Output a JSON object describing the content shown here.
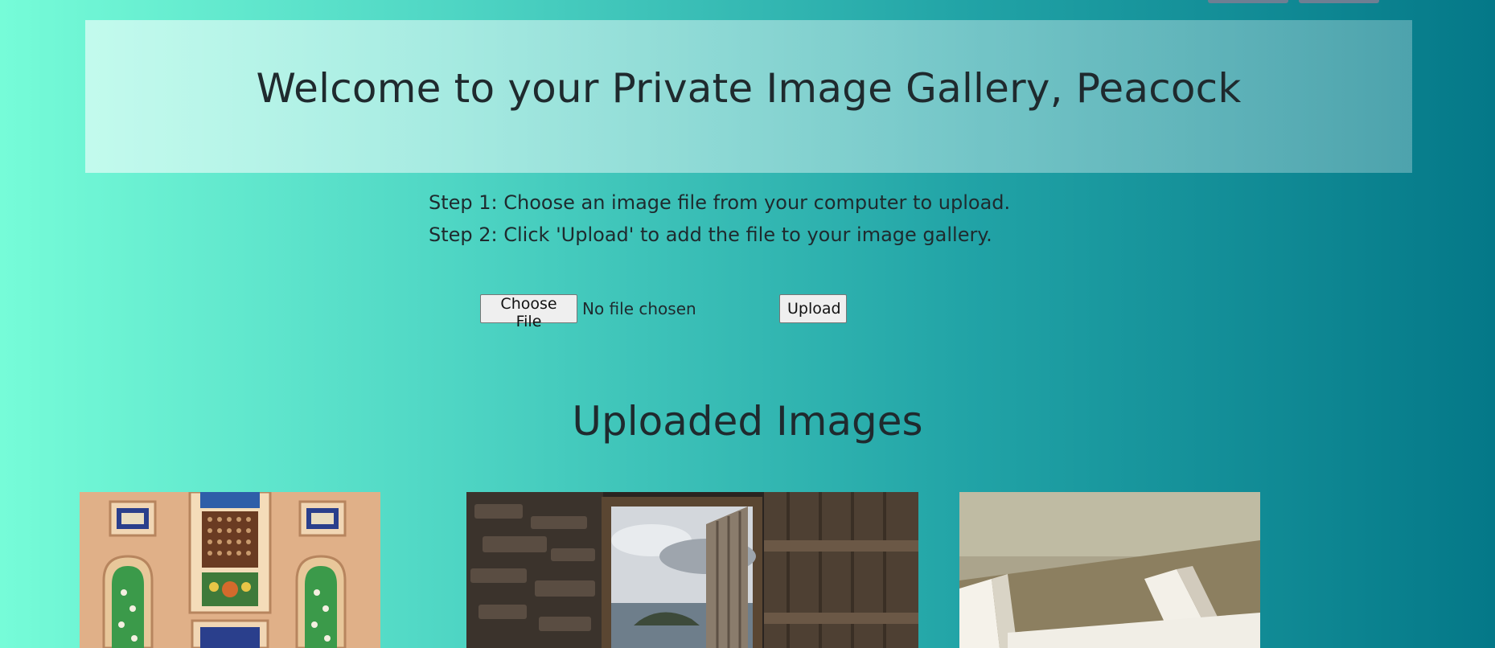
{
  "header": {
    "title": "Welcome to your Private Image Gallery, Peacock"
  },
  "instructions": {
    "step1": "Step 1: Choose an image file from your computer to upload.",
    "step2": "Step 2: Click 'Upload' to add the file to your image gallery."
  },
  "upload_form": {
    "choose_label": "Choose File",
    "file_status": "No file chosen",
    "upload_label": "Upload"
  },
  "gallery": {
    "title": "Uploaded Images",
    "images": [
      {
        "name": "ornate-tiled-facade-image"
      },
      {
        "name": "stone-doorway-sea-view-image"
      },
      {
        "name": "white-beams-architecture-image"
      }
    ]
  },
  "colors": {
    "gradient_start": "#76fcd8",
    "gradient_end": "#047888",
    "text": "#1f2a2e",
    "top_buttons": "#6e7f93"
  }
}
